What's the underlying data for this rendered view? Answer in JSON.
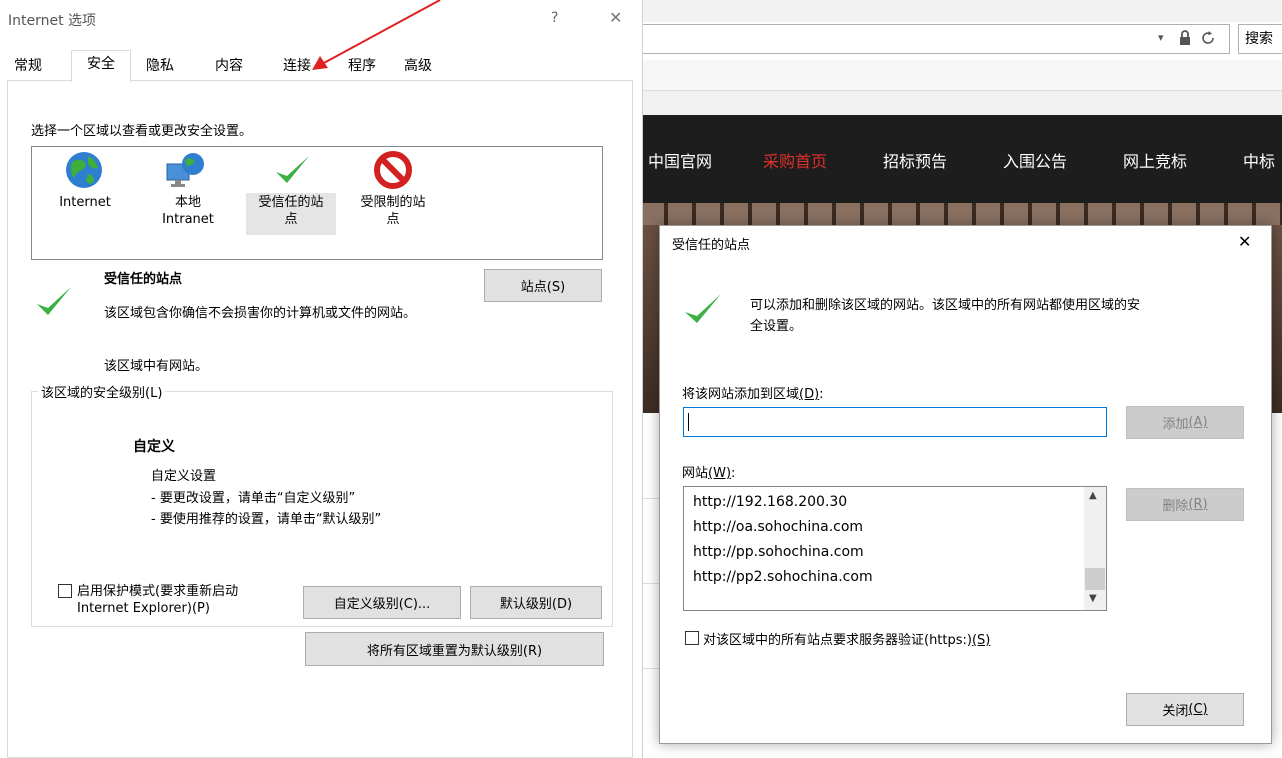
{
  "ie_options": {
    "title": "Internet 选项",
    "help_glyph": "?",
    "close_glyph": "✕",
    "tabs": [
      "常规",
      "安全",
      "隐私",
      "内容",
      "连接",
      "程序",
      "高级"
    ],
    "zone_prompt": "选择一个区域以查看或更改安全设置。",
    "zones": [
      {
        "label_line1": "Internet",
        "label_line2": "",
        "icon": "globe-icon"
      },
      {
        "label_line1": "本地",
        "label_line2": "Intranet",
        "icon": "local-intranet-icon"
      },
      {
        "label_line1": "受信任的站",
        "label_line2": "点",
        "icon": "checkmark-icon"
      },
      {
        "label_line1": "受限制的站",
        "label_line2": "点",
        "icon": "prohibited-icon"
      }
    ],
    "zone_title": "受信任的站点",
    "zone_description": "该区域包含你确信不会损害你的计算机或文件的网站。",
    "zone_sites_note": "该区域中有网站。",
    "sites_button": "站点(S)",
    "level_legend": "该区域的安全级别(L)",
    "level_name": "自定义",
    "level_desc_line1": "自定义设置",
    "level_desc_line2": "- 要更改设置，请单击“自定义级别”",
    "level_desc_line3": "- 要使用推荐的设置，请单击“默认级别”",
    "protected_mode_line1": "启用保护模式(要求重新启动",
    "protected_mode_line2": "Internet Explorer)(P)",
    "custom_level_button": "自定义级别(C)...",
    "default_level_button": "默认级别(D)",
    "reset_all_button": "将所有区域重置为默认级别(R)"
  },
  "browser": {
    "search_text": "搜索",
    "nav_items": [
      "中国官网",
      "采购首页",
      "招标预告",
      "入围公告",
      "网上竞标",
      "中标"
    ],
    "active_nav_color": "#e0302a"
  },
  "trusted_sites": {
    "title": "受信任的站点",
    "close_glyph": "✕",
    "info_line1": "可以添加和删除该区域的网站。该区域中的所有网站都使用区域的安",
    "info_line2": "全设置。",
    "add_label": "将该网站添加到区域",
    "add_label_key": "(D)",
    "add_label_colon": ":",
    "input_value": "",
    "add_button": "添加",
    "add_button_key": "(A)",
    "websites_label": "网站",
    "websites_label_key": "(W)",
    "websites_label_colon": ":",
    "sites": [
      "http://192.168.200.30",
      "http://oa.sohochina.com",
      "http://pp.sohochina.com",
      "http://pp2.sohochina.com"
    ],
    "remove_button": "删除",
    "remove_button_key": "(R)",
    "https_check": "对该区域中的所有站点要求服务器验证(https:)",
    "https_check_key": "(S)",
    "close_button": "关闭",
    "close_button_key": "(C)"
  },
  "annotation_color": "#e02020"
}
